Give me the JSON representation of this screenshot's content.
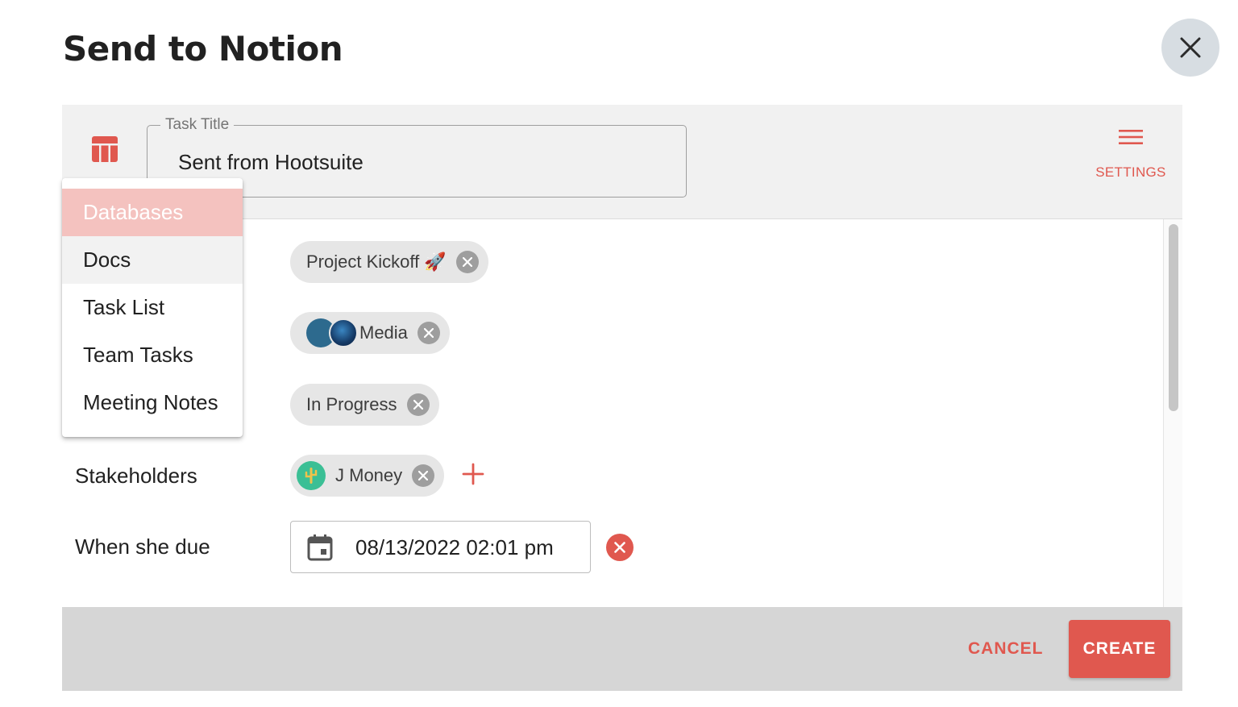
{
  "dialog": {
    "title": "Send to Notion",
    "close_icon": "close-icon"
  },
  "header": {
    "task_title_label": "Task Title",
    "task_title_value": "Sent from Hootsuite",
    "settings_label": "SETTINGS",
    "database_icon": "table-icon",
    "settings_icon": "menu-icon"
  },
  "dropdown": {
    "items": [
      {
        "label": "Databases",
        "state": "selected"
      },
      {
        "label": "Docs",
        "state": "hover"
      },
      {
        "label": "Task List",
        "state": "normal"
      },
      {
        "label": "Team Tasks",
        "state": "normal"
      },
      {
        "label": "Meeting Notes",
        "state": "normal"
      }
    ]
  },
  "fields": {
    "project_chip": "Project Kickoff 🚀",
    "media_chip": "Media",
    "status_chip": "In Progress",
    "stakeholders_label": "Stakeholders",
    "stakeholder_chip": "J Money",
    "due_label": "When she due",
    "due_value": "08/13/2022 02:01 pm"
  },
  "footer": {
    "cancel_label": "CANCEL",
    "create_label": "CREATE"
  },
  "colors": {
    "accent": "#e0584f",
    "selected_bg": "#f4c2bf",
    "panel_bg": "#f1f1f1",
    "footer_bg": "#d6d6d6"
  }
}
